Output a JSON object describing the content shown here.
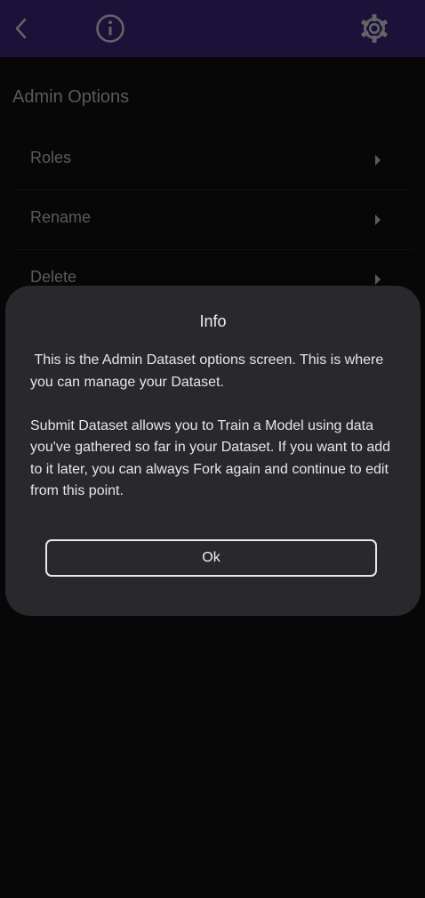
{
  "app_bar": {
    "icons": [
      "chevron-left-icon",
      "info-icon",
      "gear-icon"
    ],
    "background": "#2a1b58"
  },
  "admin": {
    "section_title": "Admin Options",
    "options": [
      {
        "label": "Roles",
        "icon": "caret-right-icon"
      },
      {
        "label": "Rename",
        "icon": "caret-right-icon"
      },
      {
        "label": "Delete",
        "icon": "caret-right-icon"
      }
    ]
  },
  "dialog": {
    "title": "Info",
    "paragraph1": " This is the Admin Dataset options screen. This is where you can manage your Dataset.",
    "paragraph2": "Submit Dataset allows you to Train a Model using data you've gathered so far in your Dataset. If you want to add to it later, you can always Fork again and continue to edit from this point.",
    "ok_label": "Ok",
    "background": "#28282d"
  }
}
